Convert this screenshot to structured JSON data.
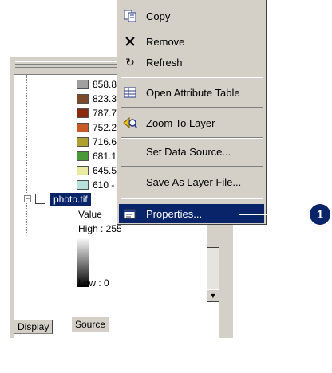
{
  "context_menu": {
    "items": [
      {
        "label": "Copy",
        "icon": "copy-icon"
      },
      {
        "label": "Remove",
        "icon": "remove-x-icon"
      },
      {
        "label": "Refresh",
        "icon": "refresh-icon"
      },
      {
        "label": "Open Attribute Table",
        "icon": "attribute-table-icon"
      },
      {
        "label": "Zoom To Layer",
        "icon": "zoom-to-layer-icon"
      },
      {
        "label": "Set Data Source...",
        "icon": ""
      },
      {
        "label": "Save As Layer File...",
        "icon": ""
      },
      {
        "label": "Properties...",
        "icon": "properties-icon"
      }
    ]
  },
  "toc": {
    "classes": [
      {
        "label": "858.8",
        "color": "#a0a0a0"
      },
      {
        "label": "823.3",
        "color": "#7a4a2a"
      },
      {
        "label": "787.7",
        "color": "#8c2a10"
      },
      {
        "label": "752.2",
        "color": "#c85a28"
      },
      {
        "label": "716.6",
        "color": "#b0a030"
      },
      {
        "label": "681.1",
        "color": "#4a9838"
      },
      {
        "label": "645.5",
        "color": "#eaeaa0"
      },
      {
        "label": "610 - ",
        "color": "#b8e0dc"
      }
    ],
    "layer_name": "photo.tif",
    "value_label": "Value",
    "high_label": "High : 255",
    "low_label": "Low : 0",
    "tabs": [
      "Display",
      "Source"
    ]
  },
  "callout": "1"
}
